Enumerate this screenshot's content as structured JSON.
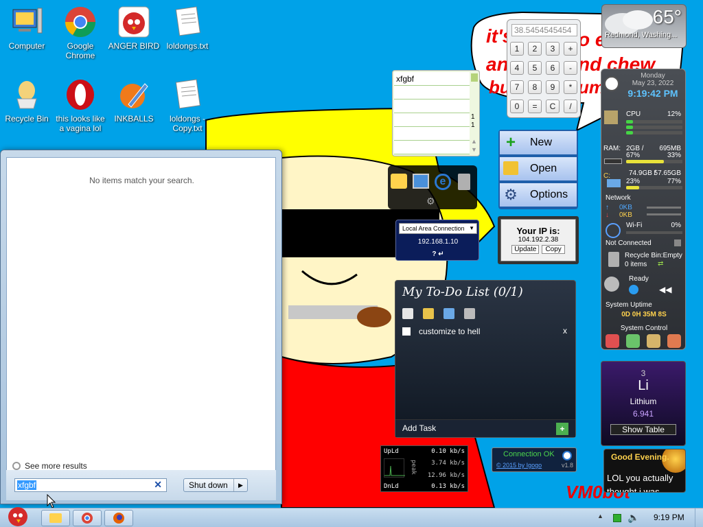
{
  "desktop_icons": [
    {
      "label": "Computer",
      "icon": "computer-icon"
    },
    {
      "label": "Google Chrome",
      "icon": "chrome-icon"
    },
    {
      "label": "ANGER BIRD",
      "icon": "angry-bird-icon"
    },
    {
      "label": "loldongs.txt",
      "icon": "text-file-icon"
    },
    {
      "label": "Recycle Bin",
      "icon": "recycle-bin-icon"
    },
    {
      "label": "this looks like a vagina lol",
      "icon": "opera-icon"
    },
    {
      "label": "INKBALLS",
      "icon": "inkball-icon"
    },
    {
      "label": "loldongs - Copy.txt",
      "icon": "text-file-icon"
    }
  ],
  "wallpaper": {
    "speech_text": "it's… e… and chew… bu…",
    "line1": "it's",
    "line1b": "o e",
    "line2": "an",
    "line2b": "nd chew",
    "line3": "bu",
    "line3b": "um",
    "signature": "VM0bot",
    "colors": {
      "sky": "#00a2e8",
      "hat": "#ffff00",
      "face": "#fff3c4",
      "shirt": "#ff0000"
    }
  },
  "start_menu": {
    "no_results": "No items match your search.",
    "see_more": "See more results",
    "search_value": "xfgbf",
    "shutdown_label": "Shut down"
  },
  "weather": {
    "temp": "65°",
    "location": "Redmond, Washing..."
  },
  "calculator": {
    "display": "38.5454545454",
    "keys": [
      [
        "1",
        "2",
        "3",
        "+"
      ],
      [
        "4",
        "5",
        "6",
        "-"
      ],
      [
        "7",
        "8",
        "9",
        "*"
      ],
      [
        "0",
        "=",
        "C",
        "/"
      ]
    ]
  },
  "notes": {
    "text": "xfgbf",
    "page_top": "1",
    "page_bottom": "1"
  },
  "launcher": {
    "new": "New",
    "open": "Open",
    "options": "Options"
  },
  "network": {
    "adapter": "Local Area Connection",
    "ip": "192.168.1.10",
    "help": "? ↵"
  },
  "your_ip": {
    "title": "Your IP is:",
    "ip": "104.192.2.38",
    "update": "Update",
    "copy": "Copy"
  },
  "sysmon": {
    "day": "Monday",
    "date": "May 23, 2022",
    "time": "9:19:42 PM",
    "cpu_label": "CPU",
    "cpu_pct": "12%",
    "cpu_val": 12,
    "ram_label": "RAM:",
    "ram_total": "2GB /",
    "ram_free": "695MB",
    "ram_pct1": "67%",
    "ram_pct2": "33%",
    "ram_val": 67,
    "disk_letter": "C:",
    "disk_a": "74.9GB /",
    "disk_b": "57.65GB",
    "disk_pct1": "23%",
    "disk_pct2": "77%",
    "disk_val": 23,
    "net_label": "Network",
    "net_up": "0KB",
    "net_down": "0KB",
    "wifi_label": "Wi-Fi",
    "wifi_pct": "0%",
    "not_connected": "Not Connected",
    "recycle": "Recycle Bin:Empty",
    "recycle_items": "0 items",
    "media_status": "Ready",
    "uptime_label": "System Uptime",
    "uptime": "0D 0H 35M 8S",
    "control_label": "System Control"
  },
  "todo": {
    "title": "My To-Do List (0/1)",
    "items": [
      "customize to hell"
    ],
    "add_task": "Add Task",
    "close": "x"
  },
  "element": {
    "number": "3",
    "symbol": "Li",
    "name": "Lithium",
    "mass": "6.941",
    "show_table": "Show Table"
  },
  "netmeter": {
    "up_label": "UpLd",
    "up": "0.10 kb/s",
    "peak_a": "3.74 kb/s",
    "peak_b": "12.96 kb/s",
    "peak_label": "peak",
    "down_label": "DnLd",
    "down": "0.13 kb/s"
  },
  "connection": {
    "status": "Connection OK",
    "credit": "© 2015 by Igogo",
    "version": "v1.8"
  },
  "greeting": {
    "title": "Good Evening.",
    "text": "LOL you actually thought i was"
  },
  "taskbar": {
    "clock": "9:19 PM",
    "show_hidden": "▲"
  }
}
